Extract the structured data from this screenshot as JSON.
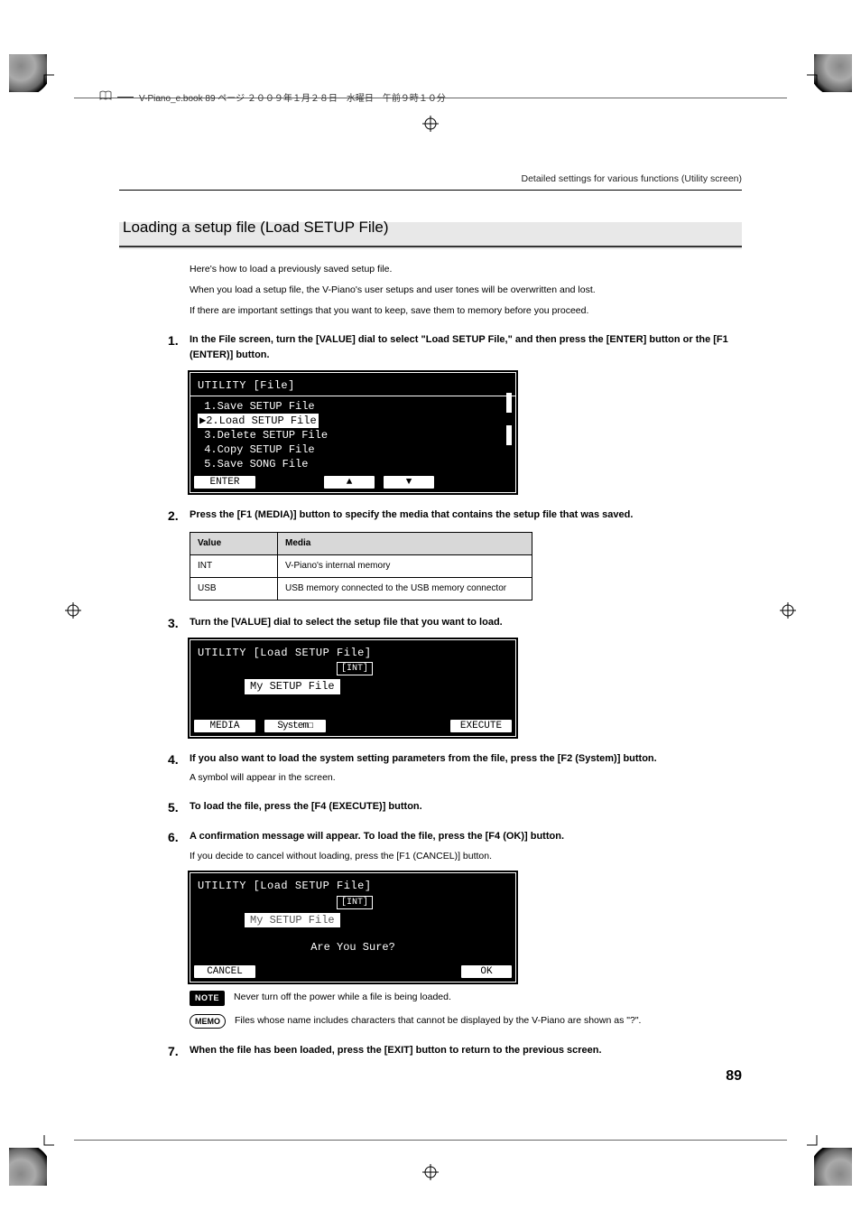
{
  "print": {
    "header_text": "V-Piano_e.book 89 ページ ２００９年１月２８日　水曜日　午前９時１０分"
  },
  "running_head": "Detailed settings for various functions (Utility screen)",
  "section_title": "Loading a setup file (Load SETUP File)",
  "intro": {
    "p1": "Here's how to load a previously saved setup file.",
    "p2": "When you load a setup file, the V-Piano's user setups and user tones will be overwritten and lost.",
    "p3": "If there are important settings that you want to keep, save them to memory before you proceed."
  },
  "steps": {
    "s1": {
      "num": "1.",
      "head": "In the File screen, turn the [VALUE] dial to select \"Load SETUP File,\" and then press the [ENTER] button or the [F1 (ENTER)] button."
    },
    "s2": {
      "num": "2.",
      "head": "Press the [F1 (MEDIA)] button to specify the media that contains the setup file that was saved."
    },
    "s3": {
      "num": "3.",
      "head": "Turn the [VALUE] dial to select the setup file that you want to load."
    },
    "s4": {
      "num": "4.",
      "head": "If you also want to load the system setting parameters from the file, press the [F2 (System)] button.",
      "p": "A symbol will appear in the screen."
    },
    "s5": {
      "num": "5.",
      "head": "To load the file, press the [F4 (EXECUTE)] button."
    },
    "s6": {
      "num": "6.",
      "head": "A confirmation message will appear. To load the file, press the [F4 (OK)] button.",
      "p": "If you decide to cancel without loading, press the [F1 (CANCEL)] button."
    },
    "s7": {
      "num": "7.",
      "head": "When the file has been loaded, press the [EXIT] button to return to the previous screen."
    }
  },
  "lcd1": {
    "title": "UTILITY [File]",
    "r1": " 1.Save SETUP File",
    "r2_sel": "▶2.Load SETUP File",
    "r3": " 3.Delete SETUP File",
    "r4": " 4.Copy SETUP File",
    "r5": " 5.Save SONG File",
    "sk1": "ENTER",
    "sk_up": "▲",
    "sk_dn": "▼"
  },
  "table": {
    "h1": "Value",
    "h2": "Media",
    "r1c1": "INT",
    "r1c2": "V-Piano's internal memory",
    "r2c1": "USB",
    "r2c2": "USB memory connected to the USB memory connector"
  },
  "lcd2": {
    "title": "UTILITY [Load SETUP File]",
    "tag": "[INT]",
    "file": "My SETUP File",
    "sk1": "MEDIA",
    "sk2": "System☐",
    "sk4": "EXECUTE"
  },
  "lcd3": {
    "title": "UTILITY [Load SETUP File]",
    "tag": "[INT]",
    "file": "My SETUP File",
    "confirm": "Are You Sure?",
    "sk1": "CANCEL",
    "sk4": "OK"
  },
  "note": {
    "label": "NOTE",
    "text": "Never turn off the power while a file is being loaded."
  },
  "memo": {
    "label": "MEMO",
    "text": "Files whose name includes characters that cannot be displayed by the V-Piano are shown as \"?\"."
  },
  "page_number": "89"
}
